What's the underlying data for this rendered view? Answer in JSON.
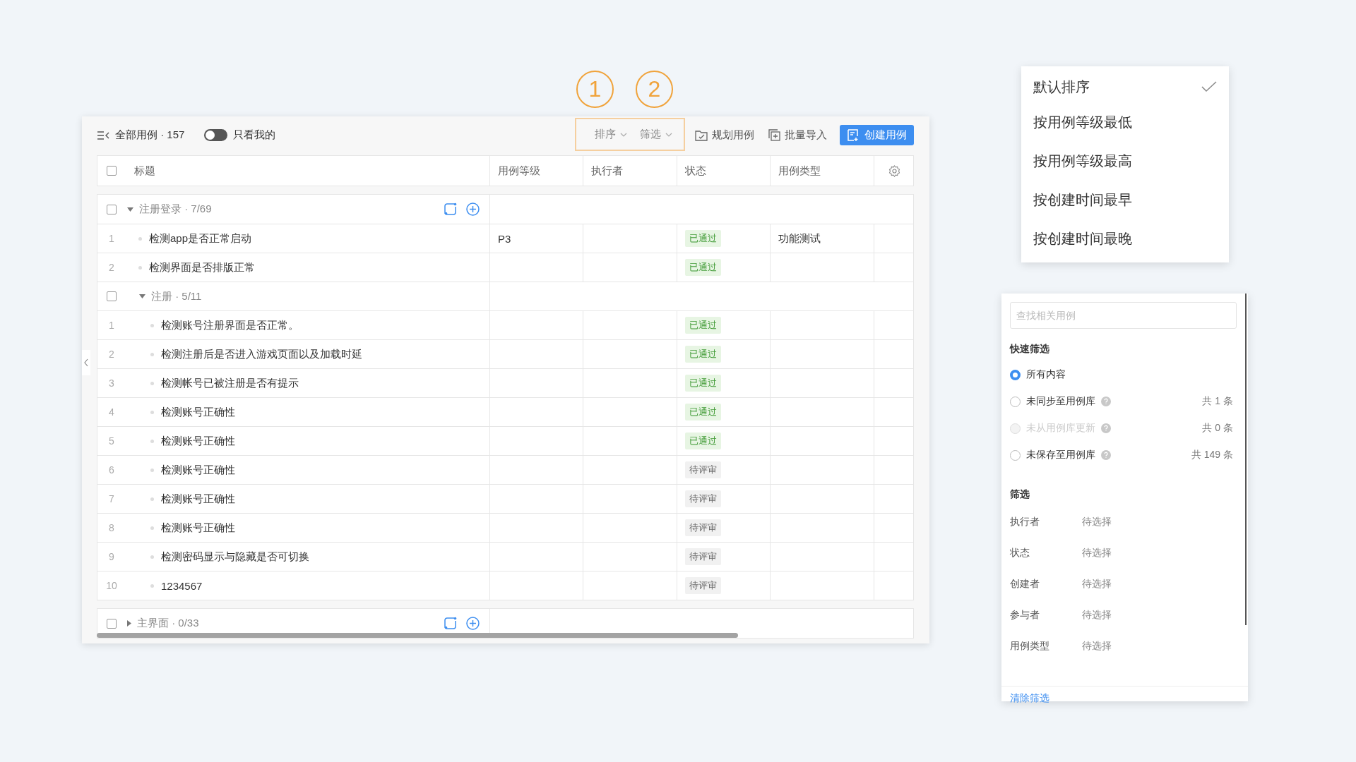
{
  "annotations": [
    {
      "label": "1"
    },
    {
      "label": "2"
    }
  ],
  "toolbar": {
    "title": "全部用例 · 157",
    "only_mine": {
      "label": "只看我的",
      "on": false
    },
    "buttons": [
      {
        "kind": "dropdown",
        "label": "排序"
      },
      {
        "kind": "dropdown",
        "label": "筛选"
      },
      {
        "kind": "plan",
        "label": "规划用例"
      },
      {
        "kind": "import",
        "label": "批量导入"
      },
      {
        "kind": "primary",
        "label": "创建用例"
      }
    ]
  },
  "table": {
    "all_checked": false,
    "columns": [
      "标题",
      "用例等级",
      "执行者",
      "状态",
      "用例类型"
    ],
    "groups": [
      {
        "title": "注册登录 · 7/69",
        "checked": false,
        "expanded": true,
        "rows": [
          {
            "number": "1",
            "title": "检测app是否正常启动",
            "level": "P3",
            "status": {
              "label": "已通过",
              "kind": "passed"
            },
            "type": "功能测试"
          },
          {
            "number": "2",
            "title": "检测界面是否排版正常",
            "status": {
              "label": "已通过",
              "kind": "passed"
            }
          }
        ],
        "children": [
          {
            "title": "注册 · 5/11",
            "checked": false,
            "expanded": true,
            "rows": [
              {
                "number": "1",
                "title": "检测账号注册界面是否正常。",
                "status": {
                  "label": "已通过",
                  "kind": "passed"
                }
              },
              {
                "number": "2",
                "title": "检测注册后是否进入游戏页面以及加载时延",
                "status": {
                  "label": "已通过",
                  "kind": "passed"
                }
              },
              {
                "number": "3",
                "title": "检测帐号已被注册是否有提示",
                "status": {
                  "label": "已通过",
                  "kind": "passed"
                }
              },
              {
                "number": "4",
                "title": "检测账号正确性",
                "status": {
                  "label": "已通过",
                  "kind": "passed"
                }
              },
              {
                "number": "5",
                "title": "检测账号正确性",
                "status": {
                  "label": "已通过",
                  "kind": "passed"
                }
              },
              {
                "number": "6",
                "title": "检测账号正确性",
                "status": {
                  "label": "待评审",
                  "kind": "pending"
                }
              },
              {
                "number": "7",
                "title": "检测账号正确性",
                "status": {
                  "label": "待评审",
                  "kind": "pending"
                }
              },
              {
                "number": "8",
                "title": "检测账号正确性",
                "status": {
                  "label": "待评审",
                  "kind": "pending"
                }
              },
              {
                "number": "9",
                "title": "检测密码显示与隐藏是否可切换",
                "status": {
                  "label": "待评审",
                  "kind": "pending"
                }
              },
              {
                "number": "10",
                "title": "1234567",
                "status": {
                  "label": "待评审",
                  "kind": "pending"
                }
              }
            ]
          }
        ]
      },
      {
        "title": "主界面 · 0/33",
        "checked": false,
        "expanded": false
      }
    ]
  },
  "sort_menu": {
    "items": [
      {
        "label": "默认排序",
        "selected": true
      },
      {
        "label": "按用例等级最低",
        "selected": false
      },
      {
        "label": "按用例等级最高",
        "selected": false
      },
      {
        "label": "按创建时间最早",
        "selected": false
      },
      {
        "label": "按创建时间最晚",
        "selected": false
      }
    ]
  },
  "filter_panel": {
    "search": {
      "placeholder": "查找相关用例"
    },
    "quick_title": "快速筛选",
    "quick_filters": [
      {
        "label": "所有内容",
        "selected": true,
        "disabled": false
      },
      {
        "label": "未同步至用例库",
        "selected": false,
        "disabled": false,
        "help": true,
        "count": "共 1 条"
      },
      {
        "label": "未从用例库更新",
        "selected": false,
        "disabled": true,
        "help": true,
        "count": "共 0 条"
      },
      {
        "label": "未保存至用例库",
        "selected": false,
        "disabled": false,
        "help": true,
        "count": "共 149 条"
      }
    ],
    "filter_title": "筛选",
    "fields": [
      {
        "label": "执行者",
        "value": "待选择"
      },
      {
        "label": "状态",
        "value": "待选择"
      },
      {
        "label": "创建者",
        "value": "待选择"
      },
      {
        "label": "参与者",
        "value": "待选择"
      },
      {
        "label": "用例类型",
        "value": "待选择"
      }
    ],
    "clear": "清除筛选"
  }
}
